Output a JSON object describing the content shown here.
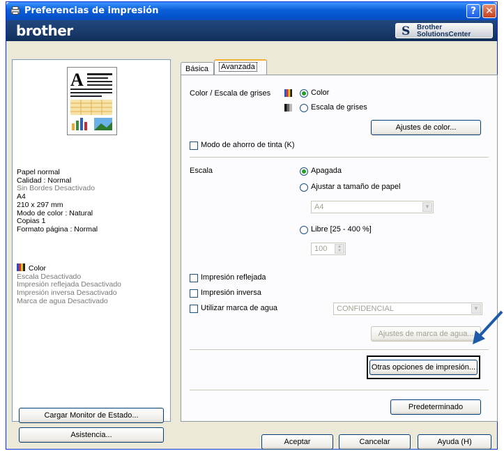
{
  "window": {
    "title": "Preferencias de impresión",
    "help_label": "?",
    "close_label": "✕",
    "brand": "brother",
    "solutions_line1": "Brother",
    "solutions_line2": "SolutionsCenter"
  },
  "summary": {
    "lines1": [
      "Papel normal",
      "Calidad  : Normal",
      "Sin Bordes Desactivado",
      "A4",
      "210 x 297 mm",
      "Modo de color : Natural",
      "Copias 1",
      "Formato página : Normal"
    ],
    "color_label": "Color",
    "lines2": [
      "Escala Desactivado",
      "Impresión reflejada Desactivado",
      "Impresión inversa Desactivado",
      "Marca de agua Desactivado"
    ]
  },
  "left_buttons": {
    "status_monitor": "Cargar Monitor de Estado...",
    "support": "Asistencia..."
  },
  "tabs": {
    "basic": "Básica",
    "advanced": "Avanzada"
  },
  "advanced": {
    "color_group_label": "Color / Escala de grises",
    "color_option": "Color",
    "grayscale_option": "Escala de grises",
    "color_settings_button": "Ajustes de color...",
    "toner_save_label": "Modo de ahorro de tinta (K)",
    "scaling_label": "Escala",
    "scaling_off": "Apagada",
    "fit_to_paper": "Ajustar a tamaño de papel",
    "paper_size_value": "A4",
    "free_label": "Libre [25 - 400 %]",
    "free_value": "100",
    "mirror_label": "Impresión reflejada",
    "reverse_label": "Impresión inversa",
    "watermark_label": "Utilizar marca de agua",
    "watermark_value": "CONFIDENCIAL",
    "watermark_settings_button": "Ajustes de marca de agua...",
    "other_options_button": "Otras opciones de impresión...",
    "default_button": "Predeterminado"
  },
  "footer": {
    "ok": "Aceptar",
    "cancel": "Cancelar",
    "help": "Ayuda (H)"
  },
  "colors": {
    "titlebar": "#0a5fd8",
    "banner": "#1a3c6e",
    "highlight_border": "#000000",
    "arrow": "#1e5aa8"
  }
}
